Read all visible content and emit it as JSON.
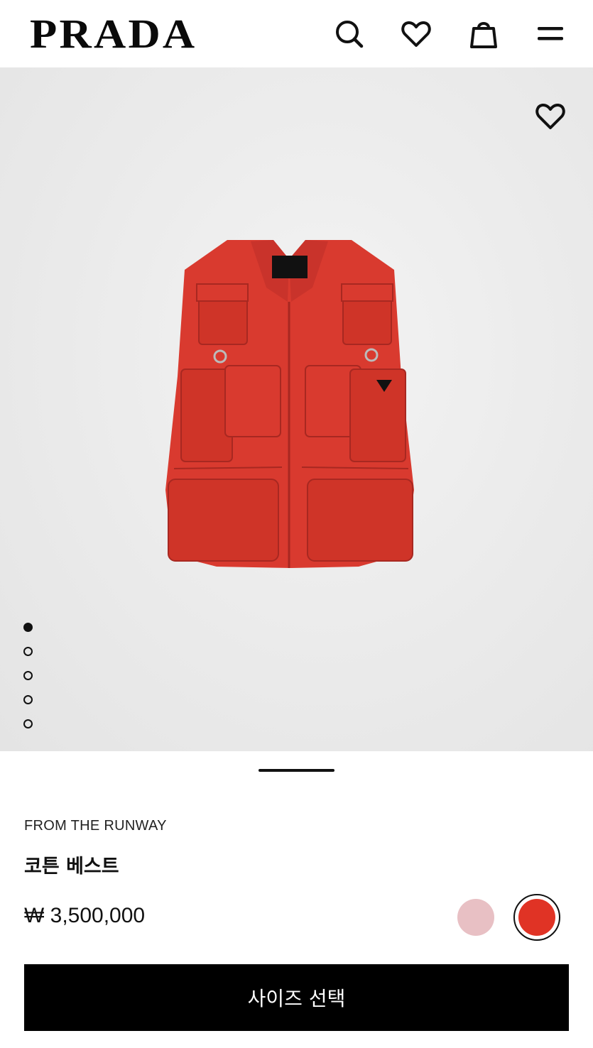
{
  "header": {
    "brand": "PRADA",
    "icons": [
      "search-icon",
      "heart-icon",
      "shopping-bag-icon",
      "menu-icon"
    ]
  },
  "gallery": {
    "image_count": 5,
    "active_index": 0,
    "product_color": "#d93a2f"
  },
  "product": {
    "collection_label": "FROM THE RUNWAY",
    "name": "코튼 베스트",
    "price": "₩ 3,500,000",
    "swatches": [
      {
        "color": "#e8c0c4",
        "selected": false
      },
      {
        "color": "#e03325",
        "selected": true
      }
    ]
  },
  "actions": {
    "select_size_label": "사이즈 선택"
  }
}
